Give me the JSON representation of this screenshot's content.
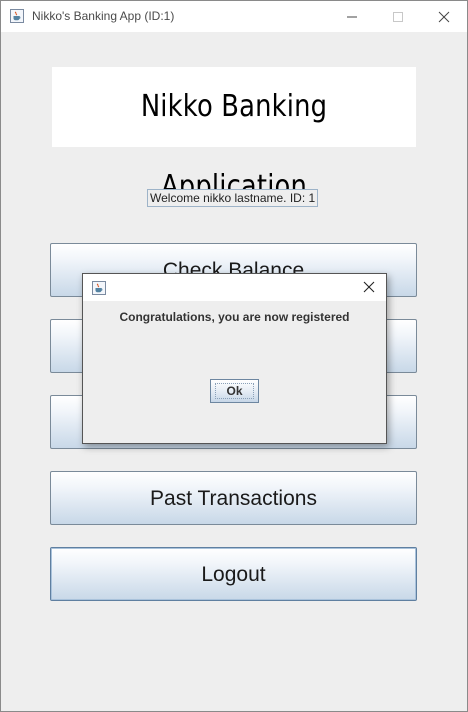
{
  "window": {
    "title": "Nikko's Banking App (ID:1)",
    "icon": "java-icon"
  },
  "header": {
    "app_title": "Nikko Banking Application"
  },
  "welcome_text": "Welcome nikko lastname. ID: 1",
  "buttons": {
    "check_balance": "Check Balance",
    "hidden_2": "",
    "hidden_3": "",
    "past_transactions": "Past Transactions",
    "logout": "Logout"
  },
  "dialog": {
    "message": "Congratulations, you are now registered",
    "ok_label": "Ok",
    "icon": "java-icon"
  },
  "colors": {
    "window_bg": "#eeeeee",
    "button_gradient_top": "#ffffff",
    "button_gradient_bottom": "#c8d8e8",
    "button_border": "#7a8a99"
  }
}
